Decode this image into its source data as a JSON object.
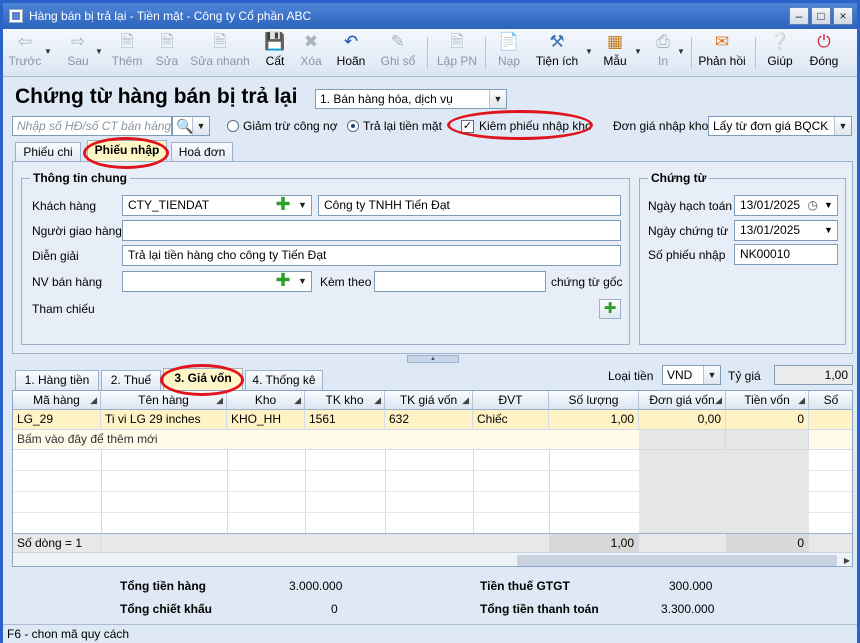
{
  "window": {
    "title": "Hàng bán bị trả lại - Tiền mặt - Công ty Cổ phần ABC"
  },
  "toolbar": {
    "items": [
      {
        "label": "Trước",
        "icon": "arrow-left-icon",
        "disabled": true
      },
      {
        "label": "Sau",
        "icon": "arrow-right-icon",
        "disabled": true
      },
      {
        "label": "Thêm",
        "icon": "new-doc-icon",
        "disabled": true
      },
      {
        "label": "Sửa",
        "icon": "edit-doc-icon",
        "disabled": true
      },
      {
        "label": "Sửa nhanh",
        "icon": "quick-edit-icon",
        "disabled": true
      },
      {
        "label": "Cất",
        "icon": "save-icon",
        "disabled": false
      },
      {
        "label": "Xóa",
        "icon": "delete-icon",
        "disabled": true
      },
      {
        "label": "Hoãn",
        "icon": "undo-icon",
        "disabled": false
      },
      {
        "label": "Ghi sổ",
        "icon": "post-icon",
        "disabled": true
      },
      {
        "label": "Lập PN",
        "icon": "receipt-icon",
        "disabled": true
      },
      {
        "label": "Nạp",
        "icon": "load-icon",
        "disabled": true
      },
      {
        "label": "Tiện ích",
        "icon": "tools-icon",
        "disabled": false
      },
      {
        "label": "Mẫu",
        "icon": "template-icon",
        "disabled": false
      },
      {
        "label": "In",
        "icon": "print-icon",
        "disabled": true
      },
      {
        "label": "Phản hồi",
        "icon": "mail-icon",
        "disabled": false
      },
      {
        "label": "Giúp",
        "icon": "help-icon",
        "disabled": false
      },
      {
        "label": "Đóng",
        "icon": "close-icon",
        "disabled": false
      }
    ]
  },
  "header": {
    "title": "Chứng từ hàng bán bị trả lại",
    "type_select": "1. Bán hàng hóa, dịch vụ",
    "search_placeholder": "Nhập số HĐ/số CT bán hàng",
    "radio_reduce_debt": "Giảm trừ công nợ",
    "radio_refund_cash": "Trả lại tiền mặt",
    "check_receipt": "Kiêm phiếu nhập kho",
    "unit_price_label": "Đơn giá nhập kho",
    "unit_price_value": "Lấy từ đơn giá BQCK"
  },
  "doc_tabs": [
    "Phiếu chi",
    "Phiếu nhập",
    "Hoá đơn"
  ],
  "general": {
    "group_title": "Thông tin chung",
    "customer_label": "Khách hàng",
    "customer_code": "CTY_TIENDAT",
    "customer_name": "Công ty TNHH Tiến Đạt",
    "deliverer_label": "Người giao hàng",
    "deliverer_value": "",
    "description_label": "Diễn giải",
    "description_value": "Trả lại tiền hàng cho công ty Tiến Đạt",
    "salesperson_label": "NV bán hàng",
    "salesperson_value": "",
    "attach_label": "Kèm theo",
    "attach_value": "",
    "attach_suffix": "chứng từ gốc",
    "reference_label": "Tham chiếu"
  },
  "voucher": {
    "group_title": "Chứng từ",
    "posting_date_label": "Ngày hạch toán",
    "posting_date": "13/01/2025",
    "voucher_date_label": "Ngày chứng từ",
    "voucher_date": "13/01/2025",
    "receipt_no_label": "Số phiếu nhập",
    "receipt_no": "NK00010"
  },
  "detail_tabs": [
    "1. Hàng tiền",
    "2. Thuế",
    "3. Giá vốn",
    "4. Thống kê"
  ],
  "currency": {
    "label": "Loại tiền",
    "value": "VND",
    "rate_label": "Tỷ giá",
    "rate_value": "1,00"
  },
  "grid": {
    "columns": [
      "Mã hàng",
      "Tên hàng",
      "Kho",
      "TK kho",
      "TK giá vốn",
      "ĐVT",
      "Số lượng",
      "Đơn giá vốn",
      "Tiền vốn",
      "Số"
    ],
    "row": {
      "code": "LG_29",
      "name": "Ti vi LG 29 inches",
      "warehouse": "KHO_HH",
      "stock_account": "1561",
      "cogs_account": "632",
      "unit": "Chiếc",
      "quantity": "1,00",
      "unit_cost": "0,00",
      "cost": "0"
    },
    "new_row_hint": "Bấm vào đây để thêm mới",
    "footer_count": "Số dòng = 1",
    "footer_quantity": "1,00",
    "footer_cost": "0"
  },
  "totals": {
    "goods_label": "Tổng tiền hàng",
    "goods_value": "3.000.000",
    "discount_label": "Tổng chiết khấu",
    "discount_value": "0",
    "vat_label": "Tiền thuế GTGT",
    "vat_value": "300.000",
    "payment_label": "Tổng tiền thanh toán",
    "payment_value": "3.300.000"
  },
  "status": {
    "text": "F6 - chon mã quy cách"
  }
}
